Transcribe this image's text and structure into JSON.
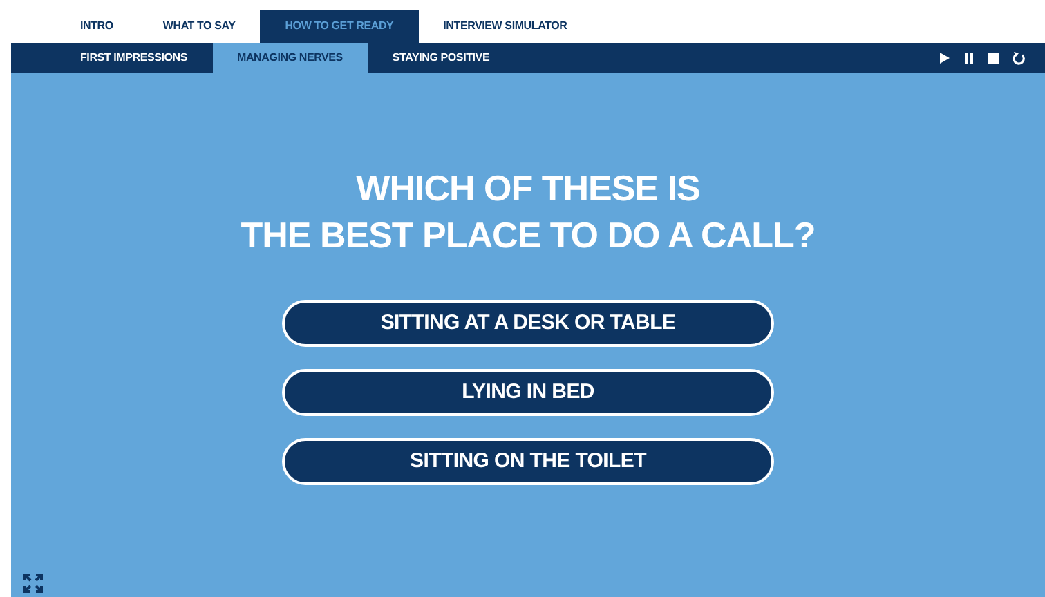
{
  "tabs": [
    {
      "label": "INTRO",
      "selected": false
    },
    {
      "label": "WHAT TO SAY",
      "selected": false
    },
    {
      "label": "HOW TO GET READY",
      "selected": true
    },
    {
      "label": "INTERVIEW SIMULATOR",
      "selected": false
    }
  ],
  "subtabs": [
    {
      "label": "FIRST IMPRESSIONS",
      "selected": false
    },
    {
      "label": "MANAGING NERVES",
      "selected": true
    },
    {
      "label": "STAYING POSITIVE",
      "selected": false
    }
  ],
  "controls": [
    {
      "kind": "play"
    },
    {
      "kind": "pause"
    },
    {
      "kind": "stop"
    },
    {
      "kind": "restart"
    }
  ],
  "question": {
    "lines": [
      "WHICH OF THESE IS",
      "THE BEST PLACE TO DO A CALL?"
    ]
  },
  "answers": [
    "SITTING AT A DESK OR TABLE",
    "LYING IN BED",
    "SITTING ON THE TOILET"
  ]
}
